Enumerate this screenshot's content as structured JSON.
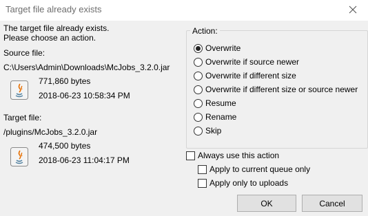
{
  "window": {
    "title": "Target file already exists",
    "close_icon": "close-icon"
  },
  "message": {
    "line1": "The target file already exists.",
    "line2": "Please choose an action."
  },
  "source": {
    "label": "Source file:",
    "path": "C:\\Users\\Admin\\Downloads\\McJobs_3.2.0.jar",
    "size": "771,860 bytes",
    "date": "2018-06-23 10:58:34 PM",
    "icon": "java-file-icon"
  },
  "target": {
    "label": "Target file:",
    "path": "/plugins/McJobs_3.2.0.jar",
    "size": "474,500 bytes",
    "date": "2018-06-23 11:04:17 PM",
    "icon": "java-file-icon"
  },
  "action": {
    "group_label": "Action:",
    "selected": "Overwrite",
    "options": [
      "Overwrite",
      "Overwrite if source newer",
      "Overwrite if different size",
      "Overwrite if different size or source newer",
      "Resume",
      "Rename",
      "Skip"
    ]
  },
  "checkboxes": {
    "always_use": "Always use this action",
    "current_queue": "Apply to current queue only",
    "uploads_only": "Apply only to uploads"
  },
  "buttons": {
    "ok": "OK",
    "cancel": "Cancel"
  }
}
